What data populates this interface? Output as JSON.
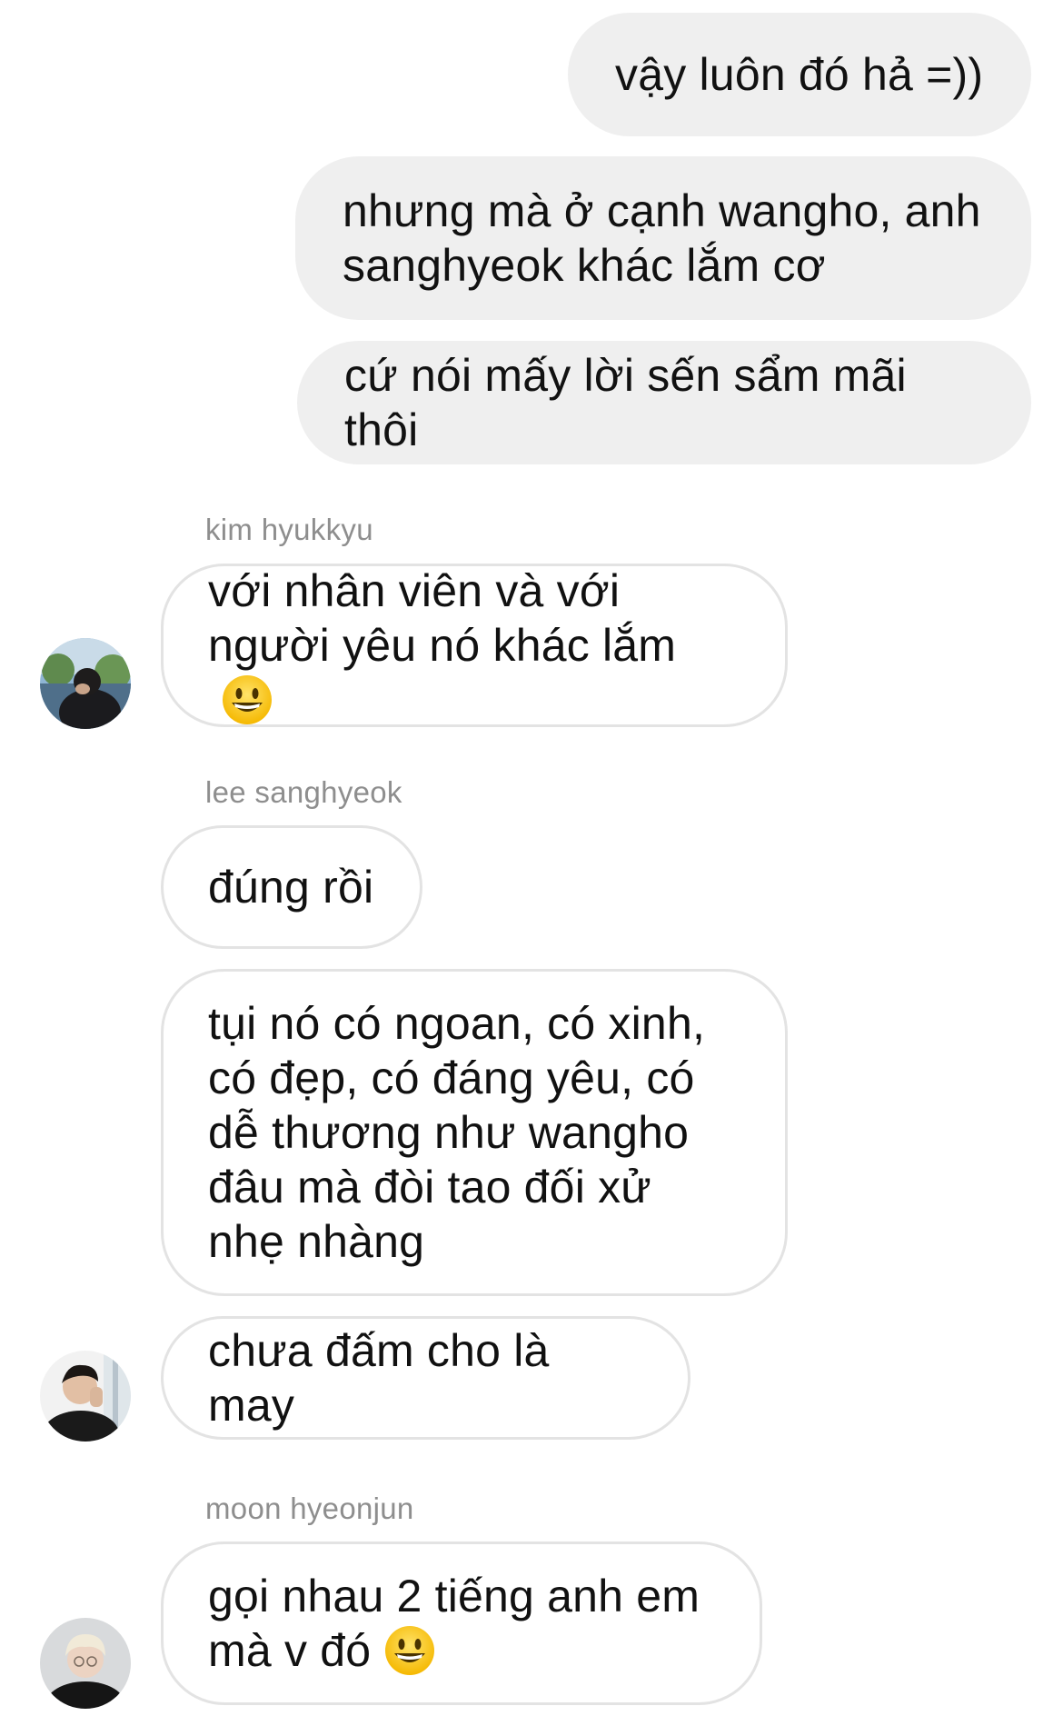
{
  "thread": {
    "outgoing": [
      {
        "text": "vậy luôn đó hả =))"
      },
      {
        "text": "nhưng mà ở cạnh wangho, anh sanghyeok khác lắm cơ"
      },
      {
        "text": "cứ nói mấy lời sến sẩm mãi thôi"
      }
    ],
    "groups": [
      {
        "sender": "kim hyukkyu",
        "messages": [
          {
            "text": "với nhân viên và với người yêu nó khác lắm",
            "emoji": "grinning-face-emoji"
          }
        ]
      },
      {
        "sender": "lee sanghyeok",
        "messages": [
          {
            "text": "đúng rồi"
          },
          {
            "text": "tụi nó có ngoan, có xinh, có đẹp, có đáng yêu, có dễ thương như wangho đâu mà đòi tao đối xử nhẹ nhàng"
          },
          {
            "text": "chưa đấm cho là may"
          }
        ]
      },
      {
        "sender": "moon hyeonjun",
        "messages": [
          {
            "text": "gọi nhau 2 tiếng anh em mà v đó",
            "emoji": "grinning-face-emoji"
          }
        ]
      }
    ]
  },
  "colors": {
    "outgoing_bubble": "#efefef",
    "incoming_border": "#e3e3e3",
    "sender_name": "#8e8e8e",
    "text": "#111111"
  }
}
